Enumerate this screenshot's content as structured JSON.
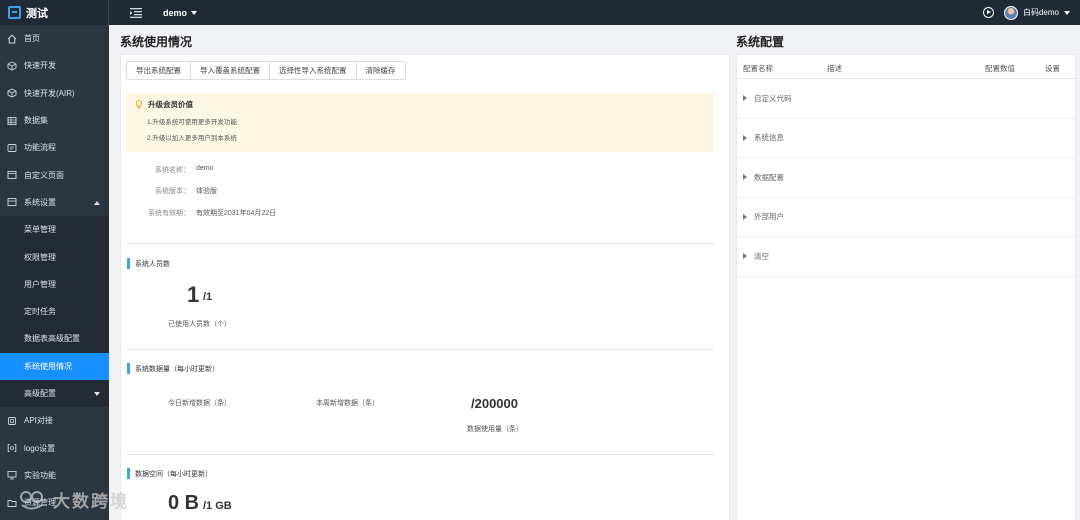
{
  "topbar": {
    "brand": "测试",
    "app_name": "demo",
    "user_name": "白码demo"
  },
  "sidebar": {
    "items": [
      {
        "label": "首页",
        "icon": "home-icon",
        "type": "top"
      },
      {
        "label": "快速开发",
        "icon": "cube-icon",
        "type": "top"
      },
      {
        "label": "快速开发(AIR)",
        "icon": "cube-icon",
        "type": "top"
      },
      {
        "label": "数据集",
        "icon": "table-icon",
        "type": "top"
      },
      {
        "label": "功能流程",
        "icon": "flow-icon",
        "type": "top"
      },
      {
        "label": "自定义页面",
        "icon": "page-icon",
        "type": "top"
      },
      {
        "label": "系统设置",
        "icon": "settings-icon",
        "type": "top",
        "expanded": true
      },
      {
        "label": "菜单管理",
        "type": "sub"
      },
      {
        "label": "权限管理",
        "type": "sub"
      },
      {
        "label": "用户管理",
        "type": "sub"
      },
      {
        "label": "定时任务",
        "type": "sub"
      },
      {
        "label": "数据表高级配置",
        "type": "sub"
      },
      {
        "label": "系统使用情况",
        "type": "sub",
        "active": true
      },
      {
        "label": "高级配置",
        "type": "sub",
        "collapsed": true
      },
      {
        "label": "API对接",
        "icon": "api-icon",
        "type": "top"
      },
      {
        "label": "logo设置",
        "icon": "image-icon",
        "type": "top"
      },
      {
        "label": "实验功能",
        "icon": "monitor-icon",
        "type": "top"
      },
      {
        "label": "资源管理",
        "icon": "folder-icon",
        "type": "top"
      }
    ]
  },
  "main": {
    "title": "系统使用情况",
    "buttons": [
      "导出系统配置",
      "导入覆盖系统配置",
      "选择性导入系统配置",
      "清除缓存"
    ],
    "notice": {
      "title": "升级会员价值",
      "lines": [
        "1.升级系统可使用更多开发功能",
        "2.升级以加入更多用户到本系统"
      ]
    },
    "info": {
      "name_label": "系统名称：",
      "name_value": "demo",
      "version_label": "系统版本：",
      "version_value": "体验版",
      "expiry_label": "系统有效期：",
      "expiry_value": "有效期至2031年04月22日"
    },
    "users": {
      "heading": "系统人员数",
      "used": "1",
      "total": "/1",
      "caption": "已使用人员数（个）"
    },
    "data_volume": {
      "heading": "系统数据量（每小时更新）",
      "today_label": "今日新增数据（条）",
      "week_label": "本周新增数据（条）",
      "total": "/200000",
      "usage_caption": "数据使用量（条）"
    },
    "storage": {
      "heading": "数据空间（每小时更新）",
      "used": "0 B",
      "total": "/1 GB"
    }
  },
  "config": {
    "title": "系统配置",
    "columns": [
      "配置名称",
      "描述",
      "配置数值",
      "设置"
    ],
    "rows": [
      "自定义代码",
      "系统信息",
      "数据配置",
      "外部用户",
      "清空"
    ]
  },
  "watermark": {
    "text": "大数跨境"
  }
}
